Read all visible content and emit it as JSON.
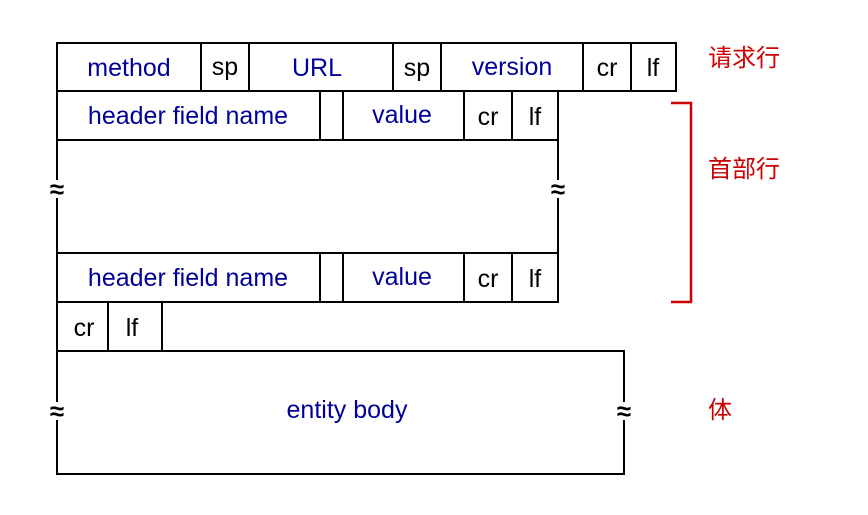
{
  "request_line": {
    "method": "method",
    "sp1": "sp",
    "url": "URL",
    "sp2": "sp",
    "version": "version",
    "cr": "cr",
    "lf": "lf"
  },
  "header_line_1": {
    "name": "header field name",
    "value": "value",
    "cr": "cr",
    "lf": "lf"
  },
  "header_line_2": {
    "name": "header field name",
    "value": "value",
    "cr": "cr",
    "lf": "lf"
  },
  "blank_line": {
    "cr": "cr",
    "lf": "lf"
  },
  "body": {
    "label": "entity body"
  },
  "omission_symbol": "≈",
  "labels": {
    "request_line": "请求行",
    "header_lines": "首部行",
    "body": "体"
  },
  "colors": {
    "field_text": "#000099",
    "label_text": "#cc0000",
    "bracket": "#cc0000"
  }
}
